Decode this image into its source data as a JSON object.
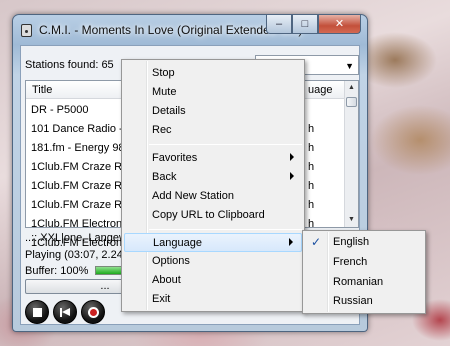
{
  "window": {
    "title": "C.M.I. - Moments In Love (Original Extended Mix)",
    "caption_buttons": {
      "minimize": "–",
      "maximize": "□",
      "close": "✕"
    }
  },
  "toolbar": {
    "stations_found": "Stations found: 65",
    "search_value": "",
    "dropdown_arrow": "▼"
  },
  "list": {
    "columns": {
      "title": "Title",
      "language": "uage"
    },
    "rows": [
      {
        "title": "DR - P5000",
        "language": ""
      },
      {
        "title": "101 Dance Radio -",
        "language": "h"
      },
      {
        "title": "181.fm - Energy 98",
        "language": "h"
      },
      {
        "title": "1Club.FM Craze Ra",
        "language": "h"
      },
      {
        "title": "1Club.FM Craze Ra",
        "language": "h"
      },
      {
        "title": "1Club.FM Craze Ra",
        "language": "h"
      },
      {
        "title": "1Club.FM Electronic",
        "language": "h"
      },
      {
        "title": "1Club.FM Electronic",
        "language": "h"
      }
    ],
    "scroll": {
      "up": "▲",
      "down": "▼"
    }
  },
  "status": {
    "now": "..:: XXL|one. Langew",
    "playing": "Playing (03:07, 2.24",
    "buffer_label": "Buffer: 100%",
    "buffer_level": 1.0,
    "more_button": "..."
  },
  "context_menu": {
    "items": [
      {
        "label": "Stop"
      },
      {
        "label": "Mute"
      },
      {
        "label": "Details"
      },
      {
        "label": "Rec"
      },
      {
        "label": "Favorites",
        "submenu": true
      },
      {
        "label": "Back",
        "submenu": true
      },
      {
        "label": "Add New Station"
      },
      {
        "label": "Copy URL to Clipboard"
      },
      {
        "label": "Language",
        "submenu": true,
        "highlighted": true
      },
      {
        "label": "Options"
      },
      {
        "label": "About"
      },
      {
        "label": "Exit"
      }
    ]
  },
  "language_submenu": {
    "items": [
      {
        "label": "English",
        "checked": true
      },
      {
        "label": "French"
      },
      {
        "label": "Romanian"
      },
      {
        "label": "Russian"
      }
    ],
    "check_glyph": "✓"
  },
  "colors": {
    "menu_highlight": "#d7e8fb",
    "buffer_fill": "#1eab1e",
    "close_button": "#c3503b"
  }
}
